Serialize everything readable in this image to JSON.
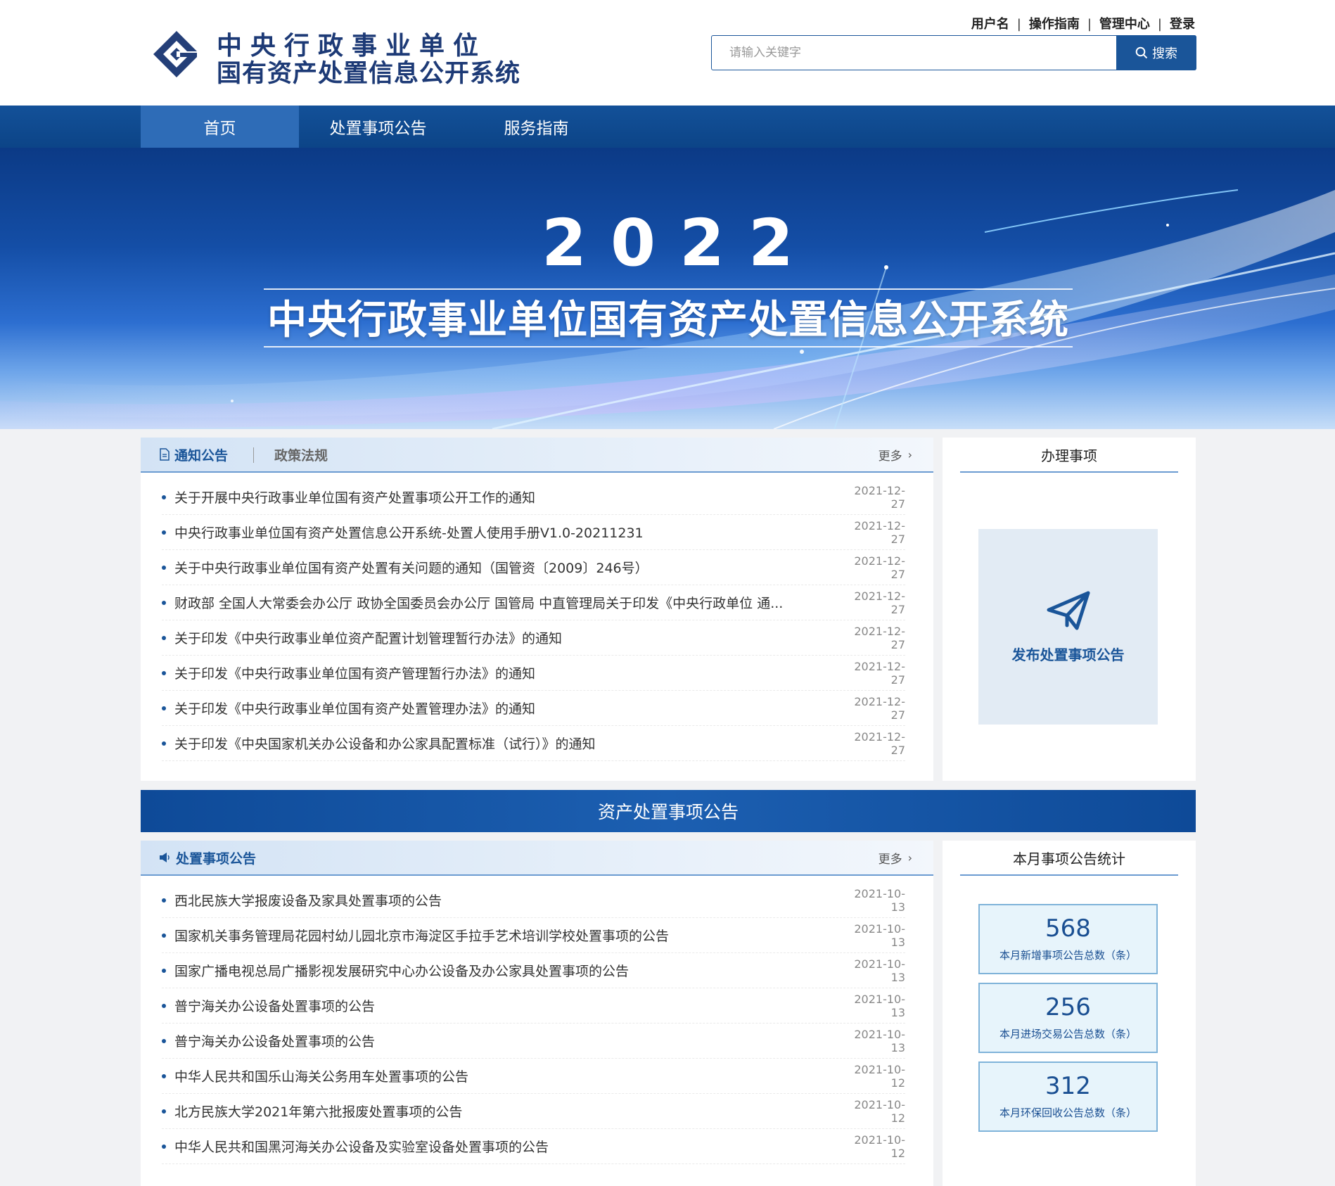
{
  "header": {
    "logo_line1": "中央行政事业单位",
    "logo_line2": "国有资产处置信息公开系统",
    "user_links": [
      "用户名",
      "操作指南",
      "管理中心",
      "登录"
    ],
    "search_placeholder": "请输入关键字",
    "search_button": "搜索"
  },
  "nav": [
    "首页",
    "处置事项公告",
    "服务指南"
  ],
  "banner": {
    "year": "2022",
    "title": "中央行政事业单位国有资产处置信息公开系统"
  },
  "notice_panel": {
    "tabs": [
      "通知公告",
      "政策法规"
    ],
    "more": "更多",
    "items": [
      {
        "title": "关于开展中央行政事业单位国有资产处置事项公开工作的通知",
        "date": "2021-12-27"
      },
      {
        "title": "中央行政事业单位国有资产处置信息公开系统-处置人使用手册V1.0-20211231",
        "date": "2021-12-27"
      },
      {
        "title": "关于中央行政事业单位国有资产处置有关问题的通知（国管资〔2009〕246号）",
        "date": "2021-12-27"
      },
      {
        "title": "财政部 全国人大常委会办公厅 政协全国委员会办公厅 国管局 中直管理局关于印发《中央行政单位 通...",
        "date": "2021-12-27"
      },
      {
        "title": "关于印发《中央行政事业单位资产配置计划管理暂行办法》的通知",
        "date": "2021-12-27"
      },
      {
        "title": "关于印发《中央行政事业单位国有资产管理暂行办法》的通知",
        "date": "2021-12-27"
      },
      {
        "title": "关于印发《中央行政事业单位国有资产处置管理办法》的通知",
        "date": "2021-12-27"
      },
      {
        "title": "关于印发《中央国家机关办公设备和办公家具配置标准（试行）》的通知",
        "date": "2021-12-27"
      }
    ]
  },
  "affairs_panel": {
    "title": "办理事项",
    "publish_label": "发布处置事项公告"
  },
  "section_strip": "资产处置事项公告",
  "disposal_panel": {
    "tab": "处置事项公告",
    "more": "更多",
    "items": [
      {
        "title": "西北民族大学报废设备及家具处置事项的公告",
        "date": "2021-10-13"
      },
      {
        "title": "国家机关事务管理局花园村幼儿园北京市海淀区手拉手艺术培训学校处置事项的公告",
        "date": "2021-10-13"
      },
      {
        "title": "国家广播电视总局广播影视发展研究中心办公设备及办公家具处置事项的公告",
        "date": "2021-10-13"
      },
      {
        "title": "普宁海关办公设备处置事项的公告",
        "date": "2021-10-13"
      },
      {
        "title": "普宁海关办公设备处置事项的公告",
        "date": "2021-10-13"
      },
      {
        "title": "中华人民共和国乐山海关公务用车处置事项的公告",
        "date": "2021-10-12"
      },
      {
        "title": "北方民族大学2021年第六批报废处置事项的公告",
        "date": "2021-10-12"
      },
      {
        "title": "中华人民共和国黑河海关办公设备及实验室设备处置事项的公告",
        "date": "2021-10-12"
      }
    ]
  },
  "stats_panel": {
    "title": "本月事项公告统计",
    "stats": [
      {
        "value": "568",
        "label": "本月新增事项公告总数（条）"
      },
      {
        "value": "256",
        "label": "本月进场交易公告总数（条）"
      },
      {
        "value": "312",
        "label": "本月环保回收公告总数（条）"
      }
    ]
  },
  "colors": {
    "brand_blue": "#1a5599",
    "nav_blue": "#0c4487",
    "logo_navy": "#1d3a76"
  }
}
